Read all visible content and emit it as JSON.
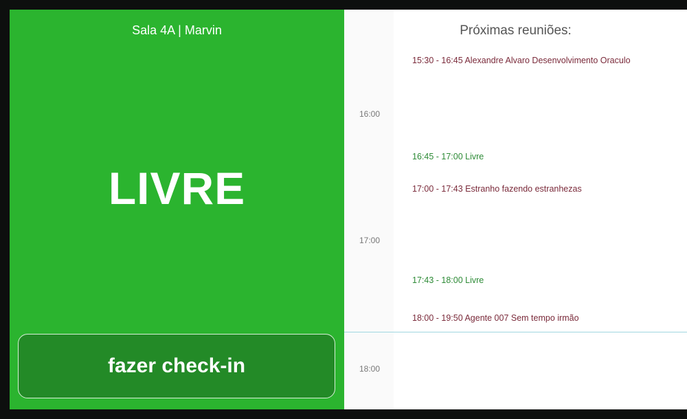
{
  "room": {
    "name": "Sala 4A | Marvin",
    "status": "LIVRE",
    "checkin_label": "fazer check-in"
  },
  "schedule": {
    "title": "Próximas reuniões:",
    "hours": [
      "16:00",
      "17:00",
      "18:00"
    ],
    "events": [
      {
        "text": "15:30 - 16:45 Alexandre Alvaro Desenvolvimento Oraculo",
        "kind": "busy"
      },
      {
        "text": "16:45 - 17:00 Livre",
        "kind": "free"
      },
      {
        "text": "17:00 - 17:43 Estranho fazendo estranhezas",
        "kind": "busy"
      },
      {
        "text": "17:43 - 18:00 Livre",
        "kind": "free"
      },
      {
        "text": "18:00 - 19:50 Agente 007 Sem tempo irmão",
        "kind": "busy"
      }
    ]
  },
  "colors": {
    "free_status": "#2bb42f",
    "busy_event": "#7a2a3a",
    "free_event": "#2e8b37"
  }
}
